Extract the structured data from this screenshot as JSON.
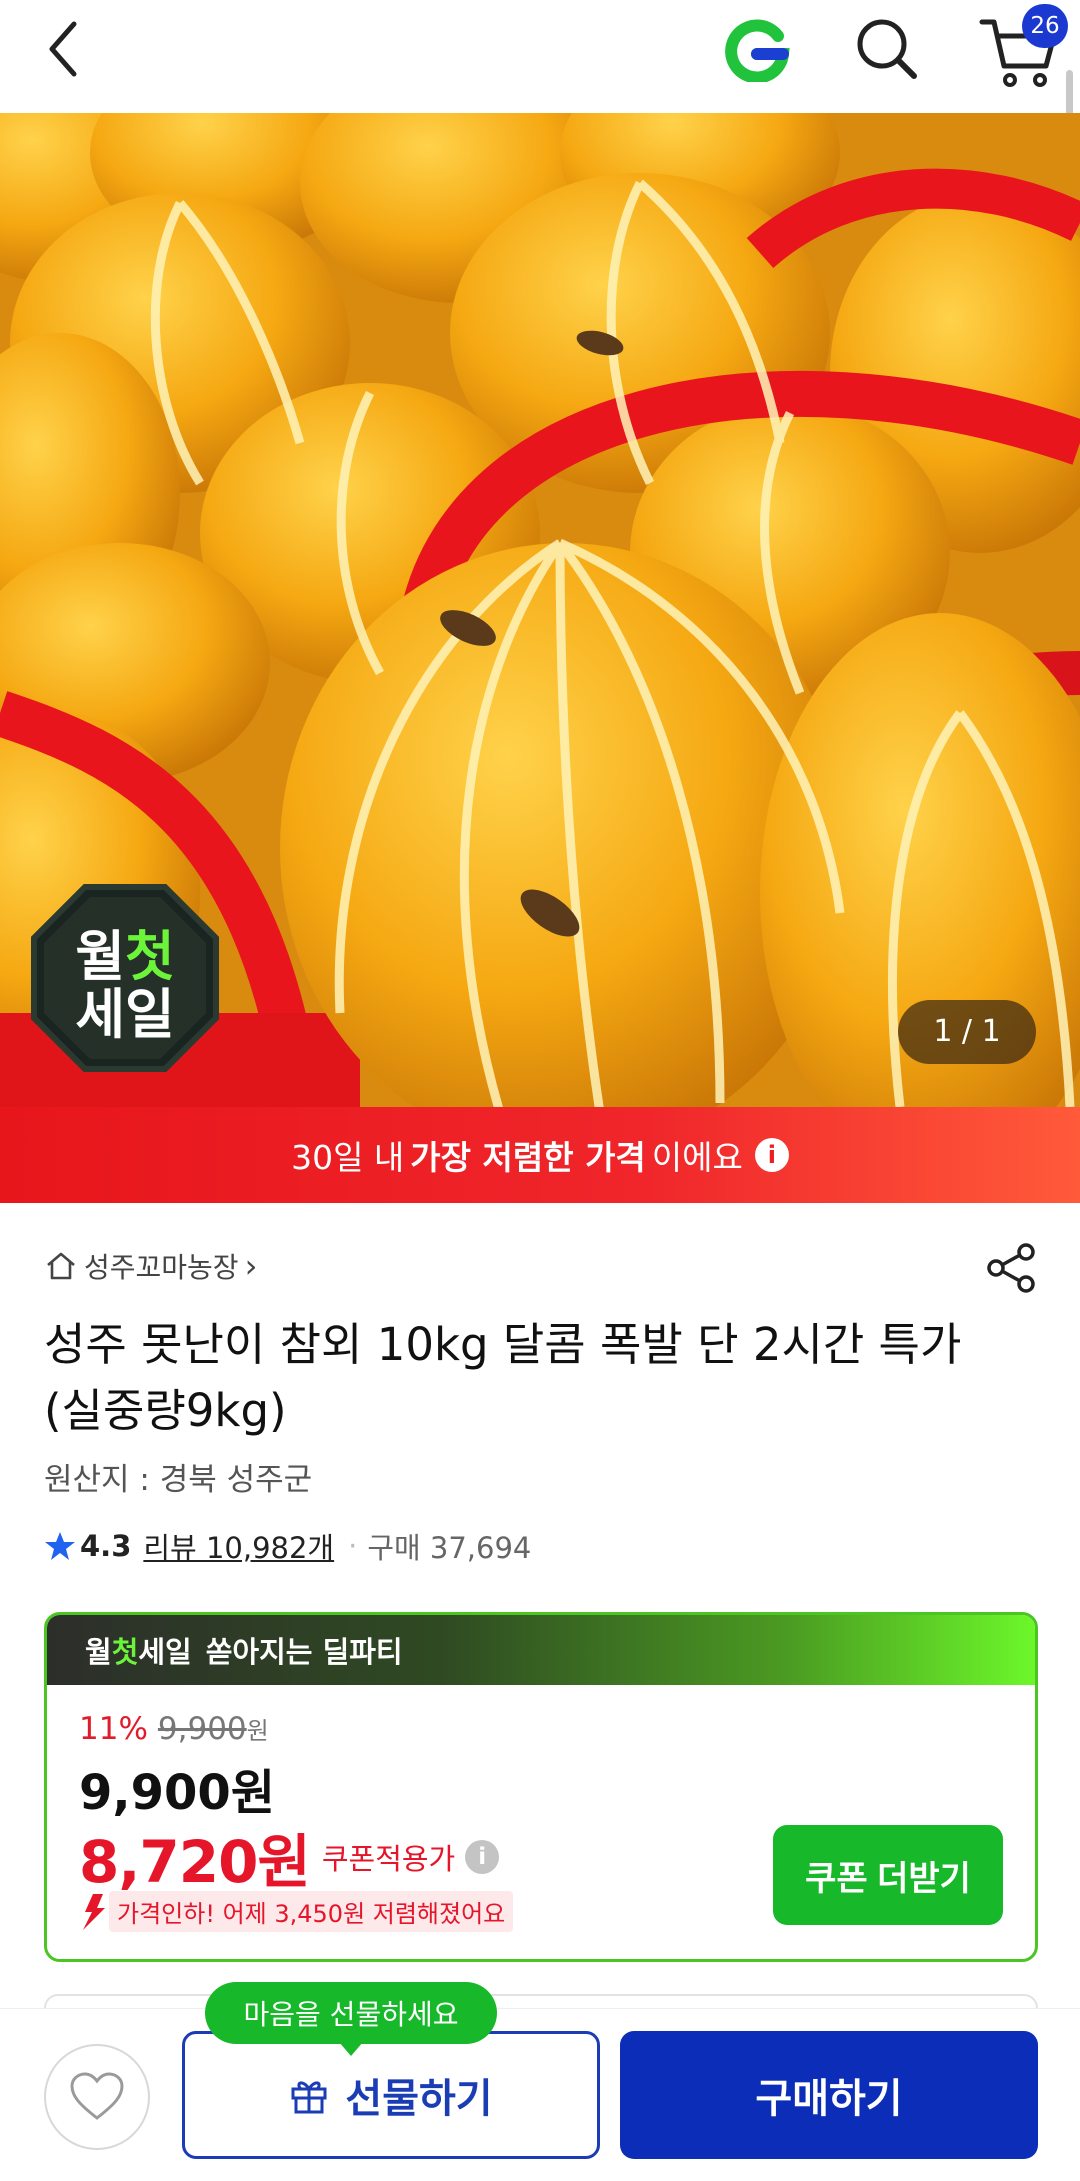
{
  "header": {
    "back_icon": "chevron-left-icon",
    "logo_icon": "g-logo-icon",
    "search_icon": "search-icon",
    "cart_icon": "cart-icon",
    "cart_count": "26"
  },
  "hero": {
    "image_alt": "참외",
    "seal_line1": "월첫",
    "seal_line2": "세일",
    "page_indicator": "1 / 1"
  },
  "price_banner": {
    "prefix": "30일 내",
    "highlight": "가장 저렴한 가격",
    "suffix": "이에요",
    "info_glyph": "i"
  },
  "product": {
    "shop_name": "성주꼬마농장",
    "shop_chevron": "›",
    "title": "성주 못난이 참외 10kg 달콤 폭발 단 2시간 특가 (실중량9kg)",
    "origin": "원산지 : 경북 성주군",
    "rating": "4.3",
    "reviews": "리뷰 10,982개",
    "separator": "·",
    "purchases": "구매 37,694"
  },
  "deal": {
    "brand_prefix": "월",
    "brand_highlight": "첫",
    "brand_suffix": "세일",
    "headline": "쏟아지는 딜파티",
    "discount_rate": "11%",
    "original_price": "9,900",
    "original_unit": "원",
    "sale_price": "9,900원",
    "coupon_price": "8,720원",
    "coupon_label": "쿠폰적용가",
    "coupon_info_glyph": "i",
    "price_drop_text": "가격인하! 어제 3,450원 저렴해졌어요",
    "coupon_button": "쿠폰 더받기"
  },
  "bottom": {
    "gift_tooltip": "마음을 선물하세요",
    "gift_button": "선물하기",
    "buy_button": "구매하기"
  },
  "colors": {
    "accent_blue": "#0b2db7",
    "sale_red": "#e5152a",
    "deal_green": "#17b92b"
  }
}
